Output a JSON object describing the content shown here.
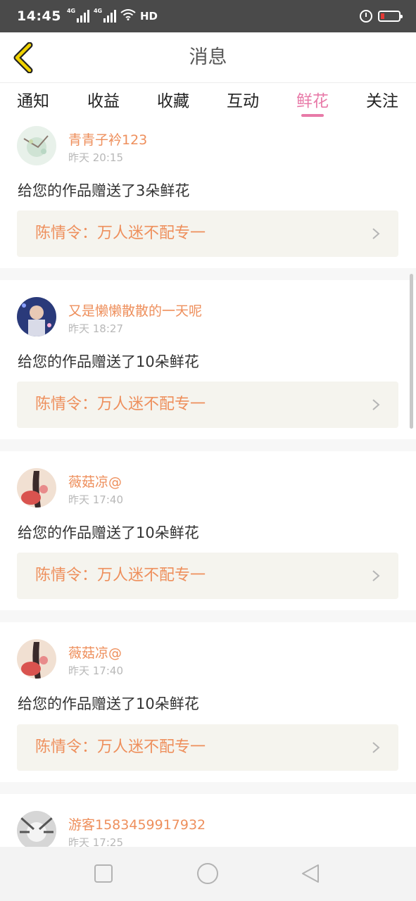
{
  "status_bar": {
    "time": "14:45",
    "network_1": "4G",
    "network_2": "4G",
    "hd": "HD",
    "icons": [
      "signal-icon",
      "signal-icon",
      "wifi-icon",
      "alarm-icon",
      "battery-icon"
    ]
  },
  "header": {
    "title": "消息",
    "back_icon": "chevron-left-icon",
    "accent_color": "#f0d200"
  },
  "tabs": [
    {
      "label": "通知",
      "active": false
    },
    {
      "label": "收益",
      "active": false
    },
    {
      "label": "收藏",
      "active": false
    },
    {
      "label": "互动",
      "active": false
    },
    {
      "label": "鲜花",
      "active": true
    },
    {
      "label": "关注",
      "active": false
    }
  ],
  "colors": {
    "active_tab": "#e87aa8",
    "username": "#ee8f5c",
    "work_title": "#ee8f5c",
    "work_bg": "#f5f4ee"
  },
  "messages": [
    {
      "username": "青青子衿123",
      "time": "昨天 20:15",
      "text": "给您的作品赠送了3朵鲜花",
      "work_title": "陈情令：万人迷不配专一"
    },
    {
      "username": "又是懒懒散散的一天呢",
      "time": "昨天 18:27",
      "text": "给您的作品赠送了10朵鲜花",
      "work_title": "陈情令：万人迷不配专一"
    },
    {
      "username": "薇菇凉@",
      "time": "昨天 17:40",
      "text": "给您的作品赠送了10朵鲜花",
      "work_title": "陈情令：万人迷不配专一"
    },
    {
      "username": "薇菇凉@",
      "time": "昨天 17:40",
      "text": "给您的作品赠送了10朵鲜花",
      "work_title": "陈情令：万人迷不配专一"
    },
    {
      "username": "游客1583459917932",
      "time": "昨天 17:25",
      "text": "",
      "work_title": ""
    }
  ],
  "nav_bar": {
    "icons": [
      "recents-square-icon",
      "home-circle-icon",
      "back-triangle-icon"
    ]
  }
}
